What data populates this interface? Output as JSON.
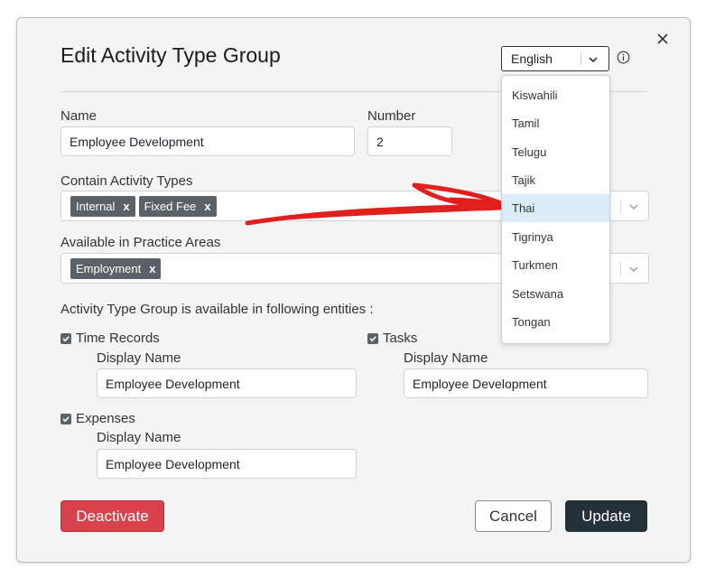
{
  "modal": {
    "title": "Edit Activity Type Group",
    "language": {
      "selected": "English",
      "options": [
        "Kiswahili",
        "Tamil",
        "Telugu",
        "Tajik",
        "Thai",
        "Tigrinya",
        "Turkmen",
        "Setswana",
        "Tongan"
      ],
      "highlighted": "Thai"
    },
    "fields": {
      "name_label": "Name",
      "name_value": "Employee Development",
      "number_label": "Number",
      "number_value": "2",
      "activity_types_label": "Contain Activity Types",
      "activity_types": [
        "Internal",
        "Fixed Fee"
      ],
      "practice_areas_label": "Available in Practice Areas",
      "practice_areas": [
        "Employment"
      ],
      "tag_remove": "x"
    },
    "entities": {
      "heading": "Activity Type Group is available in following entities :",
      "time_records": {
        "label": "Time Records",
        "checked": true,
        "display_label": "Display Name",
        "display_value": "Employee Development"
      },
      "tasks": {
        "label": "Tasks",
        "checked": true,
        "display_label": "Display Name",
        "display_value": "Employee Development"
      },
      "expenses": {
        "label": "Expenses",
        "checked": true,
        "display_label": "Display Name",
        "display_value": "Employee Development"
      }
    },
    "buttons": {
      "deactivate": "Deactivate",
      "cancel": "Cancel",
      "update": "Update"
    }
  },
  "colors": {
    "danger": "#d9424a",
    "primary_dark": "#253139",
    "tag": "#5a6268",
    "highlight": "#d9ecf8",
    "annotation_arrow": "#e0201c"
  },
  "icons": [
    "close-icon",
    "chevron-down-icon",
    "info-icon",
    "check-icon"
  ]
}
